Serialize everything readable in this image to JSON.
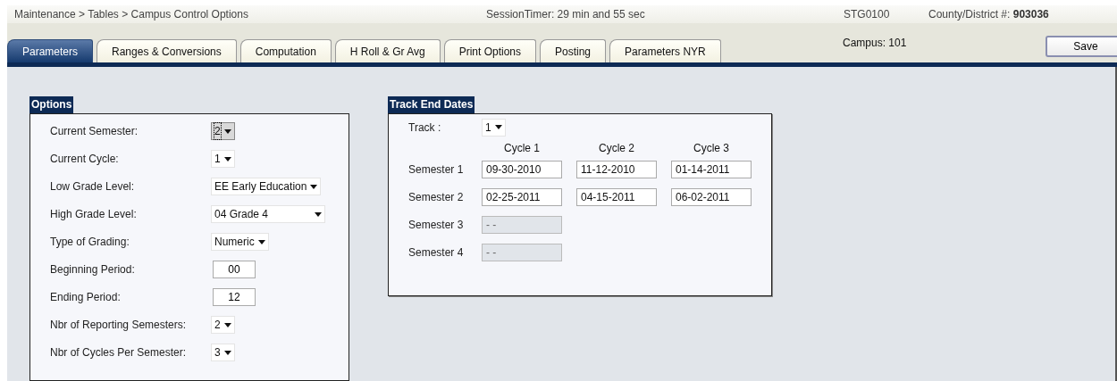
{
  "header": {
    "breadcrumb": "Maintenance > Tables > Campus Control Options",
    "session_timer": "SessionTimer: 29 min and 55 sec",
    "server": "STG0100",
    "district_label": "County/District #:",
    "district_value": "903036"
  },
  "tabs": [
    {
      "label": "Parameters",
      "selected": true
    },
    {
      "label": "Ranges & Conversions",
      "selected": false
    },
    {
      "label": "Computation",
      "selected": false
    },
    {
      "label": "H Roll & Gr Avg",
      "selected": false
    },
    {
      "label": "Print Options",
      "selected": false
    },
    {
      "label": "Posting",
      "selected": false
    },
    {
      "label": "Parameters NYR",
      "selected": false
    }
  ],
  "campus": "Campus: 101",
  "save_button": "Save",
  "options": {
    "title": "Options",
    "rows": [
      {
        "label": "Current Semester:",
        "kind": "select",
        "value": "2",
        "focused": true
      },
      {
        "label": "Current Cycle:",
        "kind": "select",
        "value": "1",
        "focused": false
      },
      {
        "label": "Low Grade Level:",
        "kind": "select",
        "value": "EE Early Education",
        "focused": false
      },
      {
        "label": "High Grade Level:",
        "kind": "select",
        "value": "04 Grade 4",
        "focused": false
      },
      {
        "label": "Type of Grading:",
        "kind": "select",
        "value": "Numeric",
        "focused": false
      },
      {
        "label": "Beginning Period:",
        "kind": "input",
        "value": "00",
        "focused": false
      },
      {
        "label": "Ending Period:",
        "kind": "input",
        "value": "12",
        "focused": false
      },
      {
        "label": "Nbr of Reporting Semesters:",
        "kind": "select",
        "value": "2",
        "focused": false
      },
      {
        "label": "Nbr of Cycles Per Semester:",
        "kind": "select",
        "value": "3",
        "focused": false
      }
    ]
  },
  "track_end_dates": {
    "title": "Track End Dates",
    "track_label": "Track :",
    "track_value": "1",
    "columns": [
      "Cycle 1",
      "Cycle 2",
      "Cycle 3"
    ],
    "rows": [
      {
        "label": "Semester 1",
        "dates": [
          {
            "value": "09-30-2010",
            "disabled": false
          },
          {
            "value": "11-12-2010",
            "disabled": false
          },
          {
            "value": "01-14-2011",
            "disabled": false
          }
        ]
      },
      {
        "label": "Semester 2",
        "dates": [
          {
            "value": "02-25-2011",
            "disabled": false
          },
          {
            "value": "04-15-2011",
            "disabled": false
          },
          {
            "value": "06-02-2011",
            "disabled": false
          }
        ]
      },
      {
        "label": "Semester 3",
        "dates": [
          {
            "value": "- -",
            "disabled": true
          }
        ]
      },
      {
        "label": "Semester 4",
        "dates": [
          {
            "value": "- -",
            "disabled": true
          }
        ]
      }
    ]
  }
}
